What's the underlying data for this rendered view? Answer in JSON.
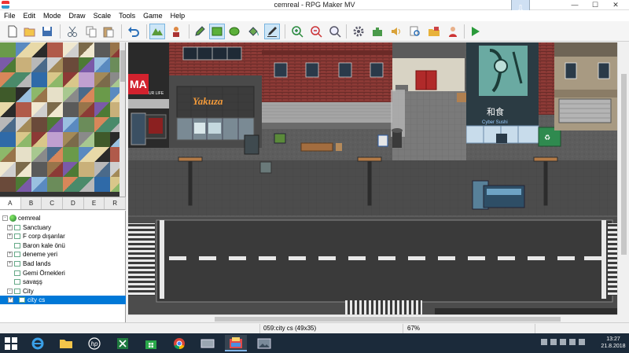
{
  "window": {
    "title": "cemreal - RPG Maker MV",
    "minimize_icon": "minimize-icon",
    "maximize_icon": "maximize-icon",
    "close_icon": "close-icon",
    "minimize": "—",
    "maximize": "☐",
    "close": "✕"
  },
  "menu": [
    "File",
    "Edit",
    "Mode",
    "Draw",
    "Scale",
    "Tools",
    "Game",
    "Help"
  ],
  "toolbar": {
    "icons": [
      "new-project-icon",
      "open-project-icon",
      "save-project-icon",
      "cut-icon",
      "copy-icon",
      "paste-icon",
      "undo-icon",
      "map-mode-icon",
      "event-mode-icon",
      "pencil-icon",
      "rectangle-icon",
      "ellipse-icon",
      "flood-fill-icon",
      "shadow-pen-icon",
      "zoom-in-icon",
      "zoom-out-icon",
      "zoom-actual-icon",
      "database-icon",
      "plugin-manager-icon",
      "sound-test-icon",
      "event-searcher-icon",
      "resource-manager-icon",
      "character-generator-icon",
      "playtest-icon"
    ],
    "active": [
      "map-mode-icon",
      "rectangle-icon",
      "shadow-pen-icon"
    ]
  },
  "tileset": {
    "tabs": [
      "A",
      "B",
      "C",
      "D",
      "E",
      "R"
    ],
    "active_tab": "A"
  },
  "map_tree": [
    {
      "label": "cemreal",
      "level": 0,
      "expander": "-",
      "root": true
    },
    {
      "label": "Sanctuary",
      "level": 1,
      "expander": "+"
    },
    {
      "label": "F corp dışarılar",
      "level": 1,
      "expander": "+"
    },
    {
      "label": "Baron kale önü",
      "level": 1,
      "expander": ""
    },
    {
      "label": "deneme yeri",
      "level": 1,
      "expander": "+"
    },
    {
      "label": "Bad lands",
      "level": 1,
      "expander": "+"
    },
    {
      "label": "Gemi Örnekleri",
      "level": 1,
      "expander": ""
    },
    {
      "label": "savaşş",
      "level": 1,
      "expander": ""
    },
    {
      "label": "City",
      "level": 1,
      "expander": "-"
    },
    {
      "label": "city cs",
      "level": 2,
      "expander": "+",
      "selected": true
    }
  ],
  "map": {
    "signs": {
      "ma": "MA",
      "ma_sub": "UR LIFE",
      "yakuza": "Yakuza",
      "sushi_kanji": "和食",
      "sushi": "Cyber Sushi"
    }
  },
  "status": {
    "map": "059:city cs (49x35)",
    "zoom": "67%"
  },
  "taskbar": {
    "apps": [
      "start-icon",
      "internet-explorer-icon",
      "file-explorer-icon",
      "hp-icon",
      "excel-icon",
      "store-icon",
      "chrome-icon",
      "network-icon",
      "rpg-maker-icon",
      "photo-viewer-icon"
    ],
    "time": "13:27",
    "date": "21.8.2018"
  },
  "colors": {
    "selection": "#0078d7",
    "taskbar": "#1b2a3a",
    "asphalt": "#3a3a3a",
    "sidewalk": "#5b5b5b",
    "brick": "#8c3a36"
  }
}
